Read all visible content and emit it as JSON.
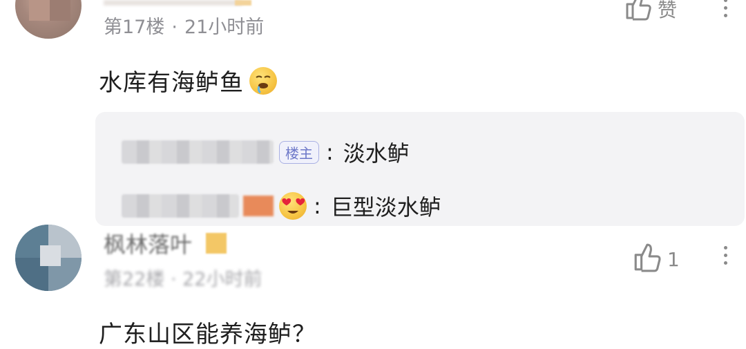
{
  "comment1": {
    "floor": "第17楼",
    "separator": "·",
    "time": "21小时前",
    "like_label": "赞",
    "text": "水库有海鲈鱼",
    "replies": [
      {
        "badge": "楼主",
        "colon": ":",
        "text": "淡水鲈"
      },
      {
        "colon": ":",
        "text": "巨型淡水鲈"
      }
    ]
  },
  "comment2": {
    "username": "枫林落叶",
    "meta": "第22楼 · 22小时前",
    "like_count": "1",
    "text": "广东山区能养海鲈？"
  },
  "icons": {
    "like": "thumbs-up-icon",
    "more": "more-vertical-icon",
    "emoji1": "drooling-face-emoji",
    "emoji2": "heart-eyes-emoji"
  },
  "colors": {
    "meta_gray": "#8f8f94",
    "reply_bg": "#f3f3f5",
    "badge_blue": "#6d78c8"
  }
}
